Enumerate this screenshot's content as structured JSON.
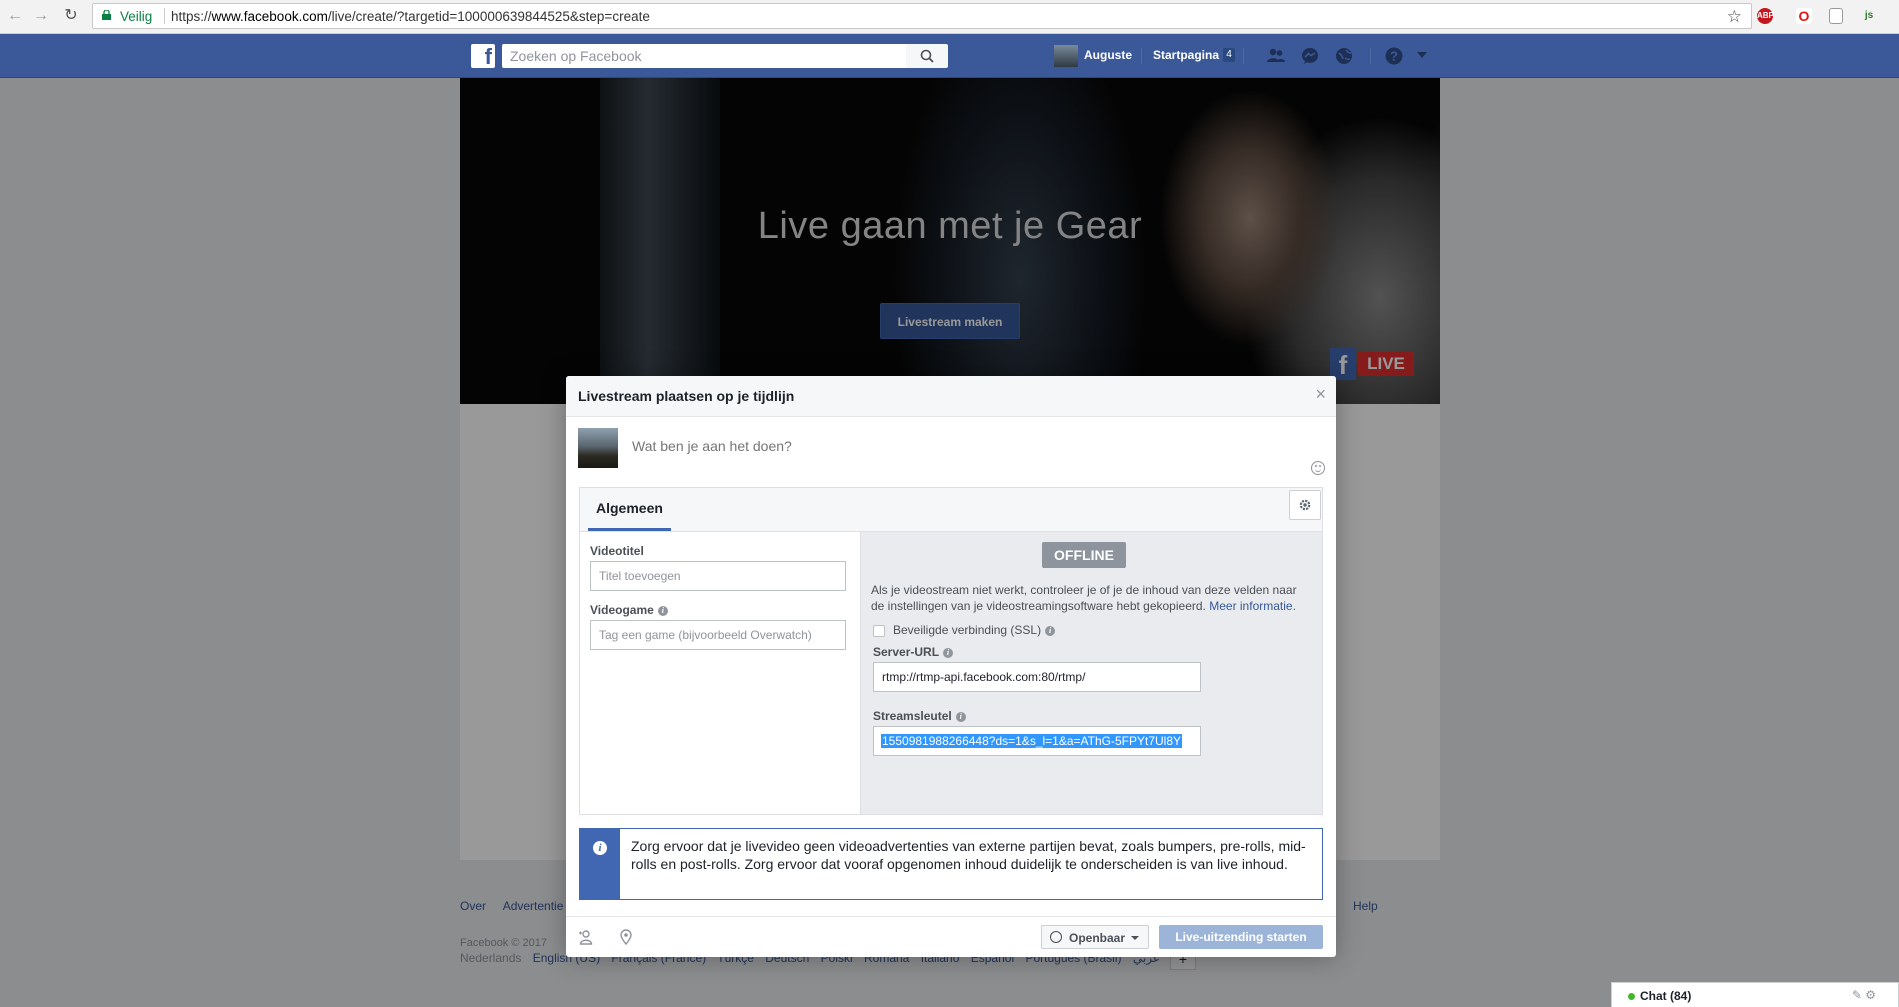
{
  "browser": {
    "secure_label": "Veilig",
    "url_prefix": "https://",
    "url_host": "www.facebook.com",
    "url_path": "/live/create/?targetid=100000639844525&step=create",
    "extensions": [
      "ABP",
      "O",
      "doc",
      "js"
    ]
  },
  "topbar": {
    "search_placeholder": "Zoeken op Facebook",
    "user_name": "Auguste",
    "home_label": "Startpagina",
    "home_count": "4"
  },
  "hero": {
    "title": "Live gaan met je Gear",
    "button_label": "Livestream maken",
    "live_badge": "LIVE"
  },
  "modal": {
    "title": "Livestream plaatsen op je tijdlijn",
    "close": "×",
    "composer_placeholder": "Wat ben je aan het doen?",
    "tab_label": "Algemeen",
    "video_title_label": "Videotitel",
    "video_title_placeholder": "Titel toevoegen",
    "video_game_label": "Videogame",
    "video_game_placeholder": "Tag een game (bijvoorbeeld Overwatch)",
    "status": "OFFLINE",
    "help_text": "Als je videostream niet werkt, controleer je of je de inhoud van deze velden naar de instellingen van je videostreamingsoftware hebt gekopieerd.",
    "help_link": "Meer informatie.",
    "ssl_label": "Beveiligde verbinding (SSL)",
    "server_url_label": "Server-URL",
    "server_url_value": "rtmp://rtmp-api.facebook.com:80/rtmp/",
    "stream_key_label": "Streamsleutel",
    "stream_key_value": "1550981988266448?ds=1&s_l=1&a=AThG-5FPYt7Ul8Y",
    "notice_text": "Zorg ervoor dat je livevideo geen videoadvertenties van externe partijen bevat, zoals bumpers, pre-rolls, mid-rolls en post-rolls. Zorg ervoor dat vooraf opgenomen inhoud duidelijk te onderscheiden is van live inhoud.",
    "audience_label": "Openbaar",
    "go_live_label": "Live-uitzending starten"
  },
  "footer": {
    "links": [
      "Over",
      "Advertentie"
    ],
    "help": "Help",
    "copyright": "Facebook © 2017",
    "current_language": "Nederlands",
    "languages": [
      "English (US)",
      "Français (France)",
      "Türkçe",
      "Deutsch",
      "Polski",
      "Română",
      "Italiano",
      "Español",
      "Português (Brasil)",
      "عربي"
    ],
    "plus": "+"
  },
  "chat": {
    "label": "Chat (84)"
  },
  "colors": {
    "fb_blue": "#3b5998",
    "button_blue": "#4267b2",
    "live_red": "#e02e2e",
    "link": "#365899",
    "secure_green": "#0b8043"
  }
}
